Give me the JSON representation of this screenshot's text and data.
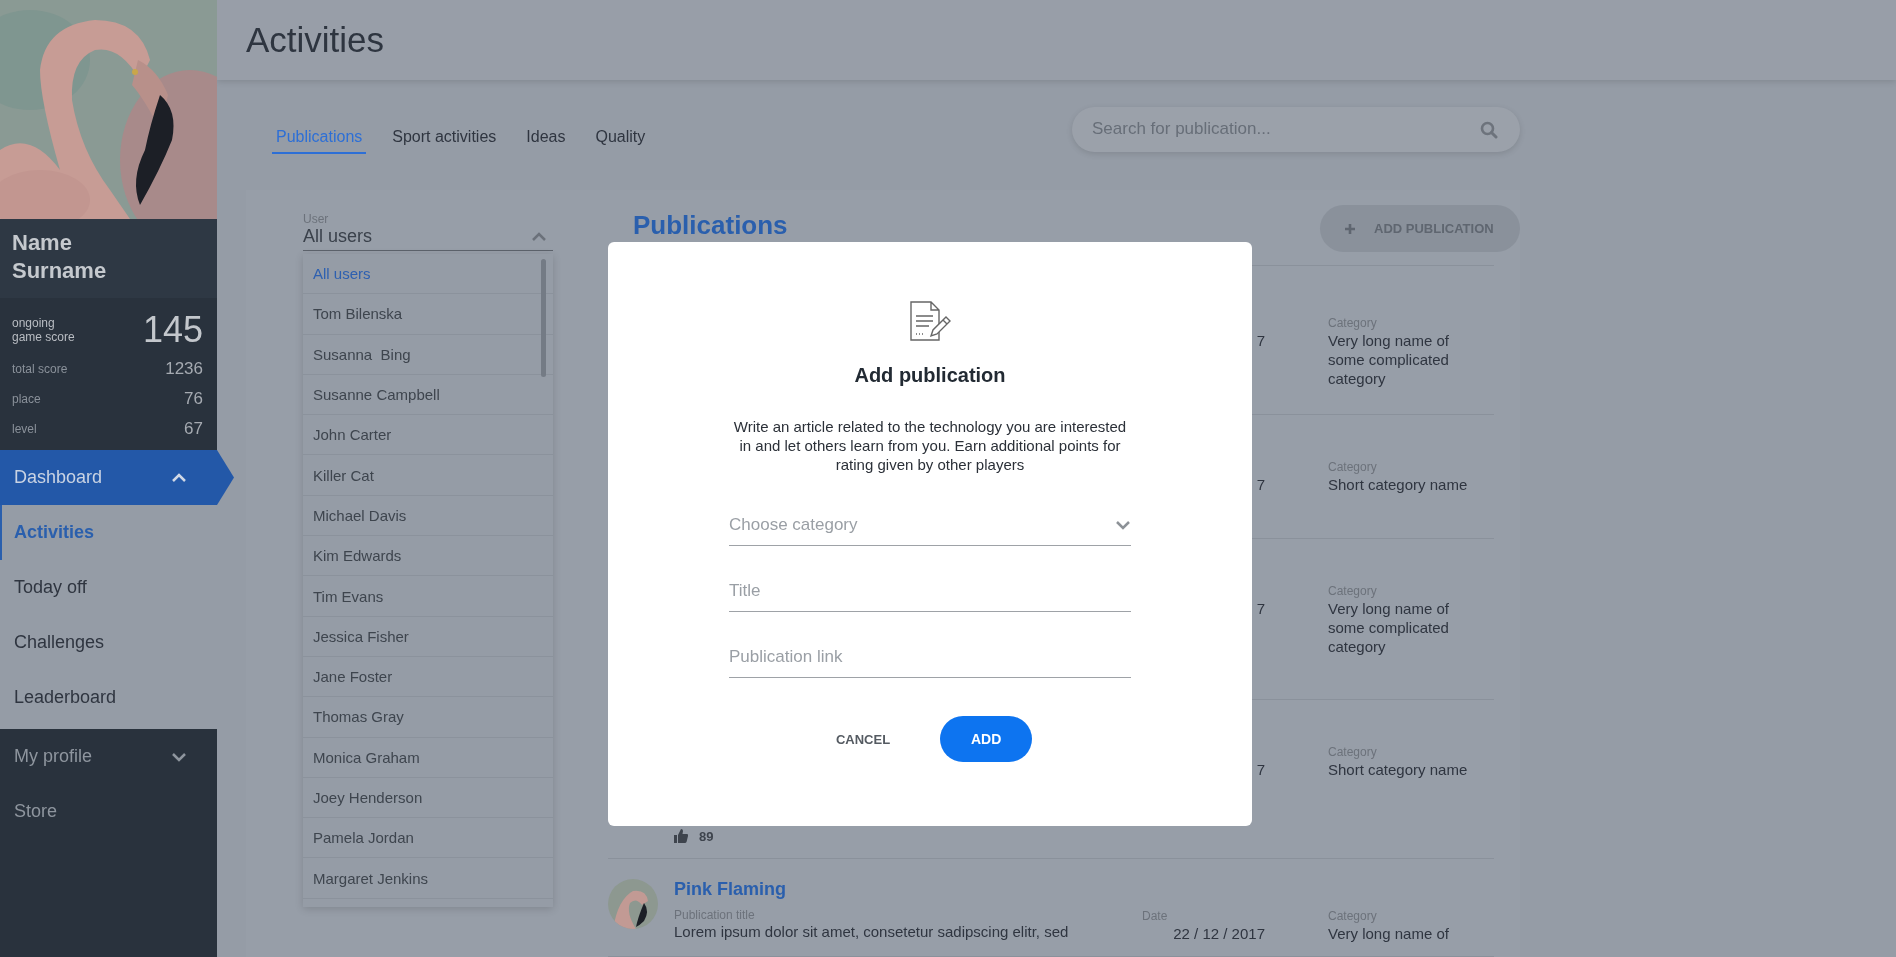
{
  "profile": {
    "name": "Name Surname",
    "stats": [
      {
        "kind": "main",
        "label": "ongoing game score",
        "value": "145"
      },
      {
        "kind": "minor",
        "label": "total score",
        "value": "1236"
      },
      {
        "kind": "minor",
        "label": "place",
        "value": "76"
      },
      {
        "kind": "minor",
        "label": "level",
        "value": "67"
      }
    ]
  },
  "nav": [
    {
      "kind": "section",
      "label": "Dashboard",
      "selected": true,
      "expanded": true,
      "children": [
        {
          "label": "Activities",
          "selected": true
        },
        {
          "label": "Today off",
          "selected": false
        },
        {
          "label": "Challenges",
          "selected": false
        },
        {
          "label": "Leaderboard",
          "selected": false
        }
      ]
    },
    {
      "kind": "section",
      "label": "My profile",
      "selected": false,
      "expanded": false
    },
    {
      "kind": "item",
      "label": "Store",
      "selected": false
    }
  ],
  "header": {
    "title": "Activities"
  },
  "tabs": [
    {
      "label": "Publications",
      "selected": true
    },
    {
      "label": "Sport activities",
      "selected": false
    },
    {
      "label": "Ideas",
      "selected": false
    },
    {
      "label": "Quality",
      "selected": false
    }
  ],
  "search": {
    "placeholder": "Search for publication..."
  },
  "user_filter": {
    "label": "User",
    "value": "All users",
    "expanded": true,
    "options": [
      {
        "label": "All users",
        "selected": true
      },
      {
        "label": "Tom Bilenska",
        "selected": false
      },
      {
        "label": "Susanna  Bing",
        "selected": false
      },
      {
        "label": "Susanne Campbell",
        "selected": false
      },
      {
        "label": "John Carter",
        "selected": false
      },
      {
        "label": "Killer Cat",
        "selected": false
      },
      {
        "label": "Michael Davis",
        "selected": false
      },
      {
        "label": "Kim Edwards",
        "selected": false
      },
      {
        "label": "Tim Evans",
        "selected": false
      },
      {
        "label": "Jessica Fisher",
        "selected": false
      },
      {
        "label": "Jane Foster",
        "selected": false
      },
      {
        "label": "Thomas Gray",
        "selected": false
      },
      {
        "label": "Monica Graham",
        "selected": false
      },
      {
        "label": "Joey Henderson",
        "selected": false
      },
      {
        "label": "Pamela Jordan",
        "selected": false
      },
      {
        "label": "Margaret Jenkins",
        "selected": false
      }
    ]
  },
  "publications": {
    "title": "Publications",
    "add_button": "ADD PUBLICATION",
    "rows": [
      {
        "date": "7",
        "category_label": "Category",
        "category": "Very long name of some complicated category"
      },
      {
        "date": "7",
        "category_label": "Category",
        "category": "Short category name"
      },
      {
        "date": "7",
        "category_label": "Category",
        "category": "Very long name of some complicated category"
      },
      {
        "date": "7",
        "category_label": "Category",
        "category": "Short category name",
        "likes": "89"
      },
      {
        "author": "Pink Flaming",
        "title_label": "Publication title",
        "title": "Lorem ipsum dolor sit amet, consetetur sadipscing elitr, sed",
        "date_label": "Date",
        "date": "22 / 12 / 2017",
        "category_label": "Category",
        "category": "Very long name of"
      }
    ]
  },
  "modal": {
    "title": "Add publication",
    "description": "Write an article related to the technology you are interested in and let others learn from you. Earn additional points for rating given by other players",
    "fields": [
      {
        "kind": "select",
        "placeholder": "Choose category"
      },
      {
        "kind": "text",
        "placeholder": "Title"
      },
      {
        "kind": "text",
        "placeholder": "Publication link"
      }
    ],
    "buttons": [
      {
        "kind": "secondary",
        "label": "CANCEL"
      },
      {
        "kind": "primary",
        "label": "ADD"
      }
    ]
  }
}
